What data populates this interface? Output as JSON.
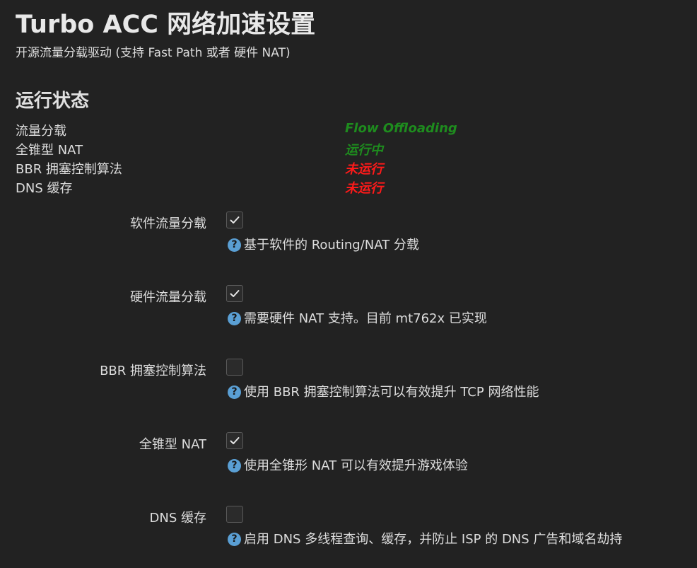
{
  "page": {
    "title": "Turbo ACC 网络加速设置",
    "subtitle": "开源流量分载驱动 (支持 Fast Path 或者 硬件 NAT)"
  },
  "status": {
    "heading": "运行状态",
    "rows": [
      {
        "label": "流量分载",
        "value": "Flow Offloading",
        "color": "#1e8c1e"
      },
      {
        "label": "全锥型 NAT",
        "value": "运行中",
        "color": "#1e8c1e"
      },
      {
        "label": "BBR 拥塞控制算法",
        "value": "未运行",
        "color": "#ff1a1a"
      },
      {
        "label": "DNS 缓存",
        "value": "未运行",
        "color": "#ff1a1a"
      }
    ]
  },
  "options": [
    {
      "label": "软件流量分载",
      "checked": true,
      "help": "基于软件的 Routing/NAT 分载",
      "help_icon": "question-icon"
    },
    {
      "label": "硬件流量分载",
      "checked": true,
      "help": "需要硬件 NAT 支持。目前 mt762x 已实现",
      "help_icon": "question-icon"
    },
    {
      "label": "BBR 拥塞控制算法",
      "checked": false,
      "help": "使用 BBR 拥塞控制算法可以有效提升 TCP 网络性能",
      "help_icon": "question-icon"
    },
    {
      "label": "全锥型 NAT",
      "checked": true,
      "help": "使用全锥形 NAT 可以有效提升游戏体验",
      "help_icon": "question-icon"
    },
    {
      "label": "DNS 缓存",
      "checked": false,
      "help": "启用 DNS 多线程查询、缓存，并防止 ISP 的 DNS 广告和域名劫持",
      "help_icon": "question-icon"
    }
  ],
  "colors": {
    "background": "#222222",
    "running": "#1e8c1e",
    "stopped": "#ff1a1a",
    "help_icon": "#5a9fd4"
  }
}
